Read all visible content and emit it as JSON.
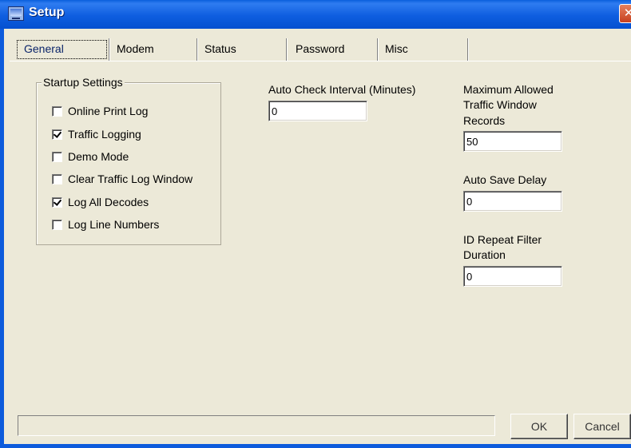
{
  "window": {
    "title": "Setup",
    "close_glyph": "✕"
  },
  "tabs": [
    "General",
    "Modem",
    "Status",
    "Password",
    "Misc"
  ],
  "startup": {
    "legend": "Startup Settings",
    "options": [
      {
        "label": "Online Print Log",
        "checked": false
      },
      {
        "label": "Traffic Logging",
        "checked": true
      },
      {
        "label": "Demo Mode",
        "checked": false
      },
      {
        "label": "Clear Traffic Log Window",
        "checked": false
      },
      {
        "label": "Log All Decodes",
        "checked": true
      },
      {
        "label": "Log Line Numbers",
        "checked": false
      }
    ]
  },
  "fields": {
    "auto_check": {
      "label": "Auto Check Interval (Minutes)",
      "value": "0"
    },
    "max_records": {
      "label_line1": "Maximum Allowed",
      "label_line2": "Traffic Window",
      "label_line3": "Records",
      "value": "50"
    },
    "auto_save": {
      "label": "Auto Save Delay",
      "value": "0"
    },
    "id_repeat": {
      "label_line1": "ID Repeat Filter",
      "label_line2": "Duration",
      "value": "0"
    }
  },
  "status_text": "",
  "buttons": {
    "ok": "OK",
    "cancel": "Cancel"
  },
  "icons": {
    "app": "computer-monitor-icon",
    "close": "close-icon"
  }
}
